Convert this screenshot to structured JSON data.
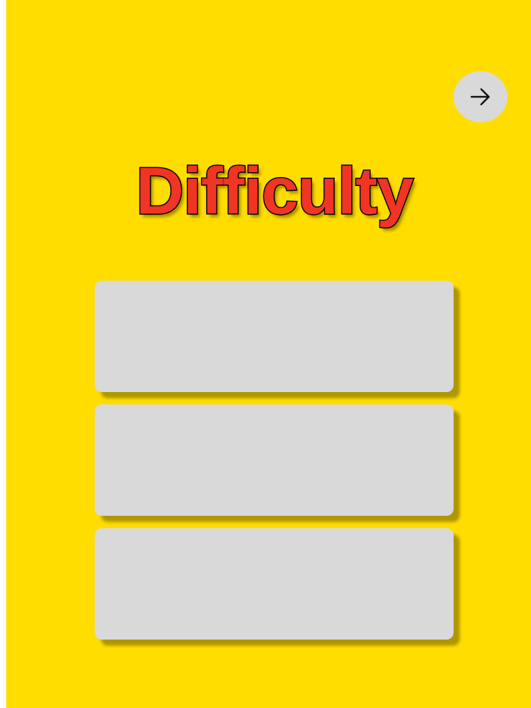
{
  "screen": {
    "background_color": "#FFDD00",
    "title": "Difficulty",
    "title_color": "#F03524",
    "next_button": {
      "icon": "arrow-right-icon"
    },
    "options": [
      {
        "label": ""
      },
      {
        "label": ""
      },
      {
        "label": ""
      }
    ]
  }
}
